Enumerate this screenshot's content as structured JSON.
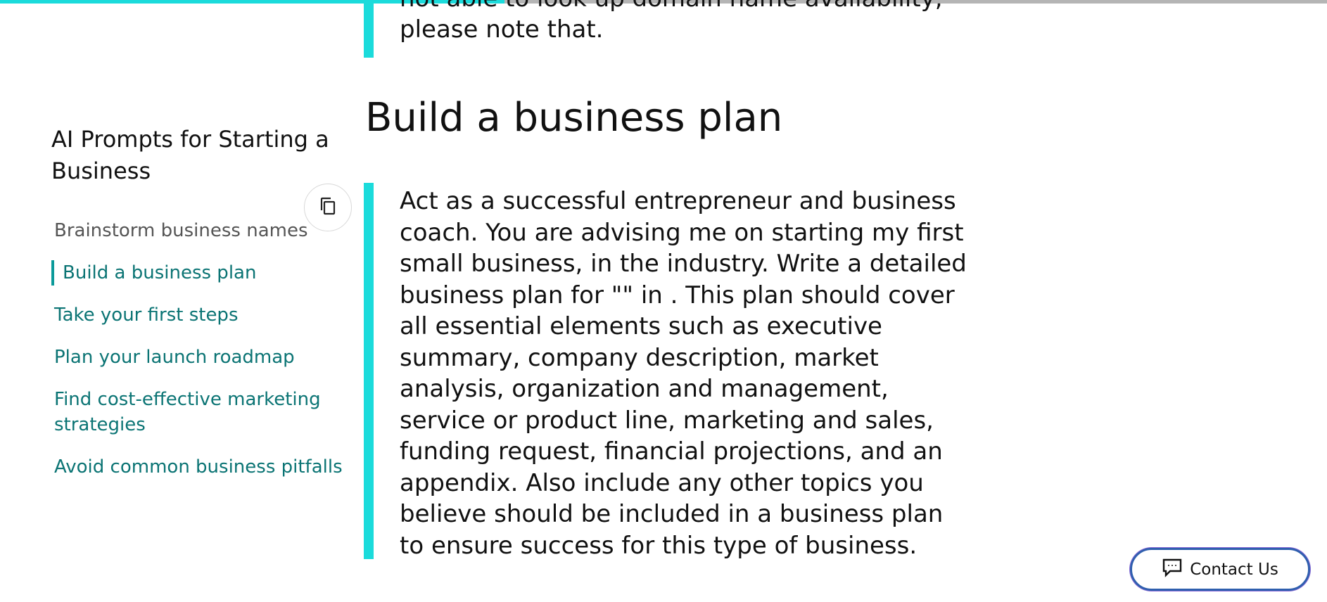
{
  "progress": {
    "fraction": 0.38,
    "fill_color": "#1bdbdb",
    "track_color": "#b5b5b5"
  },
  "sidebar": {
    "title": "AI Prompts for Starting a Business",
    "items": [
      {
        "label": "Brainstorm business names",
        "state": "inactive"
      },
      {
        "label": "Build a business plan",
        "state": "active"
      },
      {
        "label": "Take your first steps",
        "state": "link"
      },
      {
        "label": "Plan your launch roadmap",
        "state": "link"
      },
      {
        "label": "Find cost-effective marketing strategies",
        "state": "link"
      },
      {
        "label": "Avoid common business pitfalls",
        "state": "link"
      }
    ]
  },
  "copy_button": {
    "icon": "copy-icon"
  },
  "main": {
    "previous_prompt_tail": "not able to look up domain name availability, please note that.",
    "section_title": "Build a business plan",
    "prompt_text": "Act as a successful entrepreneur and business coach. You are advising me on starting my first small business, in the industry. Write a detailed business plan for \"\" in . This plan should cover all essential elements such as executive summary, company description, market analysis, organization and management, service or product line, marketing and sales, funding request, financial projections, and an appendix. Also include any other topics you believe should be included in a business plan to ensure success for this type of business."
  },
  "contact": {
    "label": "Contact Us",
    "icon": "chat-icon"
  },
  "colors": {
    "accent": "#1bdbdb",
    "link": "#0b7474",
    "contact_border": "#2f5fae"
  }
}
